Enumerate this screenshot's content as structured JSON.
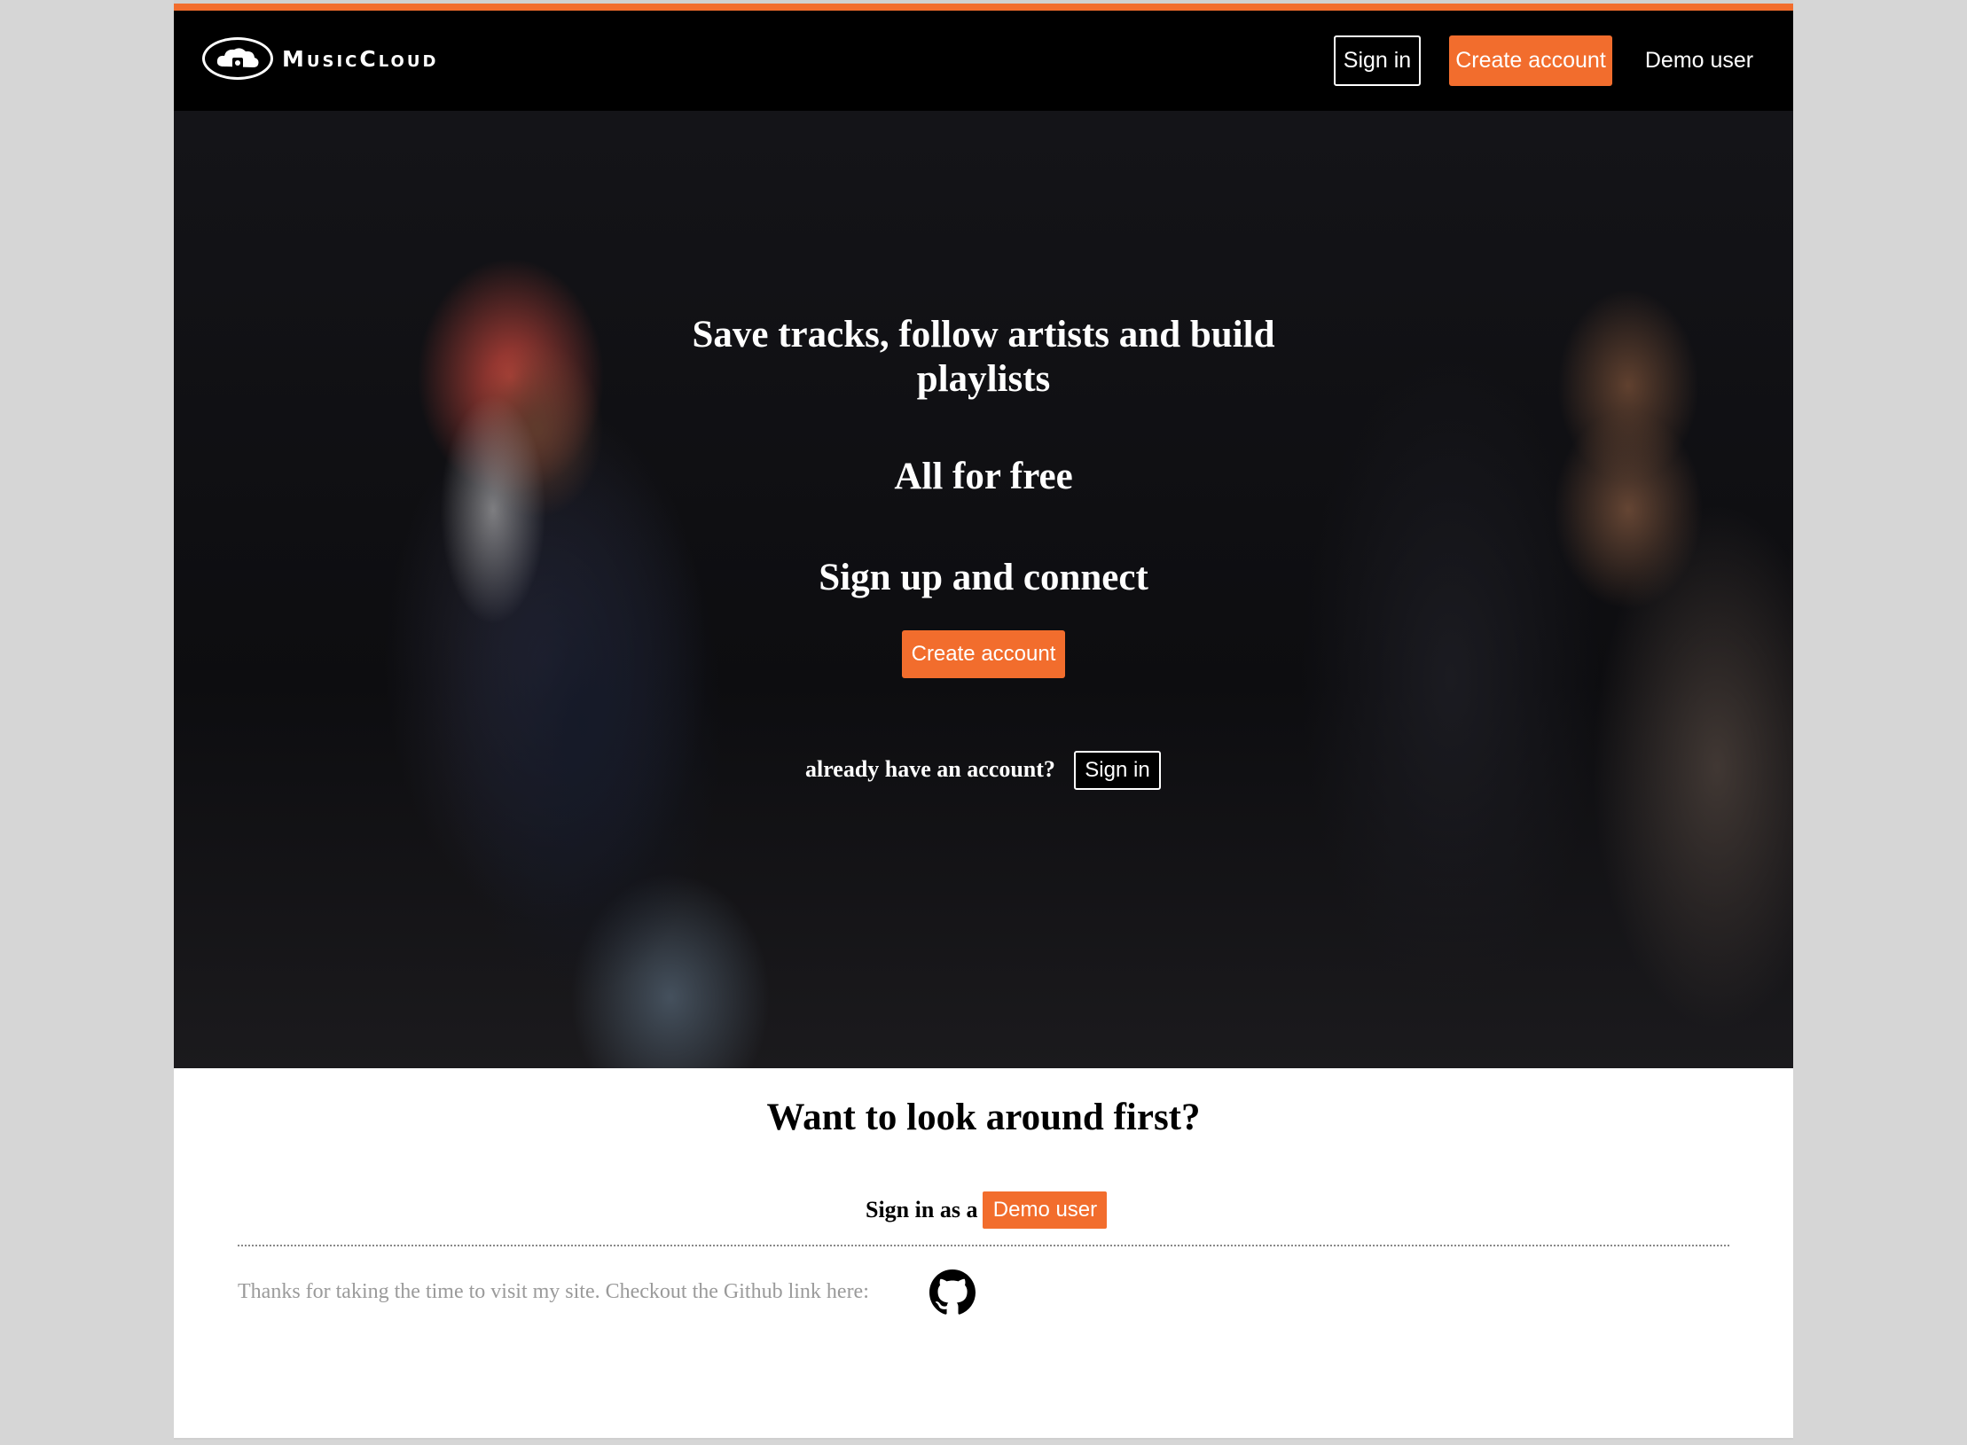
{
  "brand": {
    "name": "MusicCloud",
    "accent_color": "#f26d2d"
  },
  "nav": {
    "signin_label": "Sign in",
    "create_label": "Create account",
    "demo_label": "Demo user"
  },
  "hero": {
    "title_line1": "Save tracks, follow artists and build",
    "title_line2": "playlists",
    "free_text": "All for free",
    "signup_text": "Sign up and connect",
    "create_label": "Create account",
    "already_text": "already have an account?",
    "signin_label": "Sign in"
  },
  "explore": {
    "heading": "Want to look around first?",
    "demo_prefix": "Sign in as a",
    "demo_button": "Demo user"
  },
  "footer": {
    "text": "Thanks for taking the time to visit my site. Checkout the Github link here:",
    "github_icon": "github-icon"
  }
}
